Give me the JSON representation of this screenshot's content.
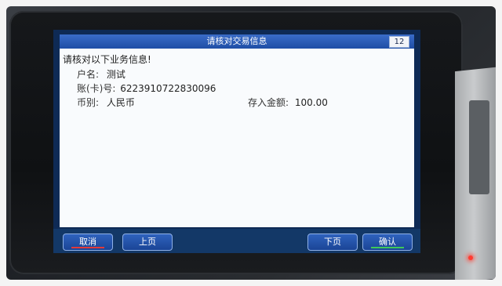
{
  "screen": {
    "title": "请核对交易信息",
    "counter": "12",
    "prompt": "请核对以下业务信息!"
  },
  "fields": {
    "account_name": {
      "label": "户名:",
      "value": "测试"
    },
    "card_number": {
      "label": "账(卡)号:",
      "value": "6223910722830096"
    },
    "currency": {
      "label": "币别:",
      "value": "人民币"
    },
    "deposit_amount": {
      "label": "存入金额:",
      "value": "100.00"
    }
  },
  "buttons": {
    "cancel": "取消",
    "prev_page": "上页",
    "next_page": "下页",
    "confirm": "确认"
  },
  "colors": {
    "title_bar": "#1f4ea6",
    "button": "#2f62be",
    "cancel_underline": "#e23a3a",
    "confirm_underline": "#3ec95a",
    "indicator": "#ff3b30"
  }
}
